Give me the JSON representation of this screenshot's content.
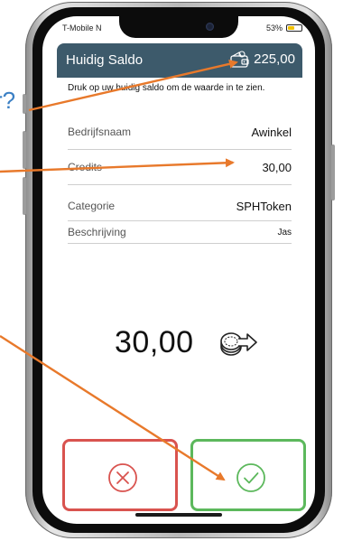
{
  "status_bar": {
    "carrier": "T-Mobile N",
    "battery_percent": "53%",
    "battery_level": 0.53
  },
  "header": {
    "title": "Huidig Saldo",
    "balance": "225,00"
  },
  "hint": "Druk op uw huidig saldo om de waarde in te zien.",
  "rows": [
    {
      "label": "Bedrijfsnaam",
      "value": "Awinkel"
    },
    {
      "label": "Credits",
      "value": "30,00"
    },
    {
      "label": "Categorie",
      "value": "SPHToken"
    },
    {
      "label": "Beschrijving",
      "value": "Jas"
    }
  ],
  "amount": "30,00",
  "annotation": {
    "partial_text": "r?",
    "color": "#e8792b"
  },
  "colors": {
    "header": "#3d5a6b",
    "cancel": "#d9534f",
    "confirm": "#5cb85c",
    "question": "#3a7fc4"
  },
  "icons": {
    "wallet": "wallet-icon",
    "coins": "coins-transfer-icon",
    "cancel": "circle-x-icon",
    "confirm": "circle-check-icon"
  }
}
